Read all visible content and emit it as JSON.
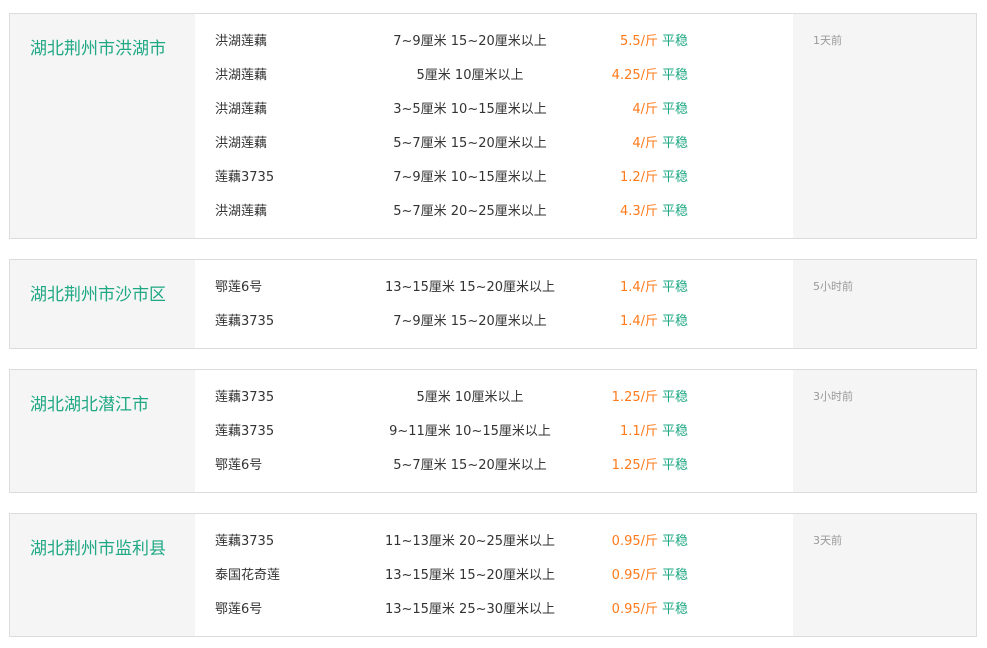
{
  "markets": [
    {
      "region": "湖北荆州市洪湖市",
      "time": "1天前",
      "rows": [
        {
          "variety": "洪湖莲藕",
          "spec": "7~9厘米 15~20厘米以上",
          "price": "5.5/斤",
          "trend": "平稳"
        },
        {
          "variety": "洪湖莲藕",
          "spec": "5厘米 10厘米以上",
          "price": "4.25/斤",
          "trend": "平稳"
        },
        {
          "variety": "洪湖莲藕",
          "spec": "3~5厘米 10~15厘米以上",
          "price": "4/斤",
          "trend": "平稳"
        },
        {
          "variety": "洪湖莲藕",
          "spec": "5~7厘米 15~20厘米以上",
          "price": "4/斤",
          "trend": "平稳"
        },
        {
          "variety": "莲藕3735",
          "spec": "7~9厘米 10~15厘米以上",
          "price": "1.2/斤",
          "trend": "平稳"
        },
        {
          "variety": "洪湖莲藕",
          "spec": "5~7厘米 20~25厘米以上",
          "price": "4.3/斤",
          "trend": "平稳"
        }
      ]
    },
    {
      "region": "湖北荆州市沙市区",
      "time": "5小时前",
      "rows": [
        {
          "variety": "鄂莲6号",
          "spec": "13~15厘米 15~20厘米以上",
          "price": "1.4/斤",
          "trend": "平稳"
        },
        {
          "variety": "莲藕3735",
          "spec": "7~9厘米 15~20厘米以上",
          "price": "1.4/斤",
          "trend": "平稳"
        }
      ]
    },
    {
      "region": "湖北湖北潜江市",
      "time": "3小时前",
      "rows": [
        {
          "variety": "莲藕3735",
          "spec": "5厘米 10厘米以上",
          "price": "1.25/斤",
          "trend": "平稳"
        },
        {
          "variety": "莲藕3735",
          "spec": "9~11厘米 10~15厘米以上",
          "price": "1.1/斤",
          "trend": "平稳"
        },
        {
          "variety": "鄂莲6号",
          "spec": "5~7厘米 15~20厘米以上",
          "price": "1.25/斤",
          "trend": "平稳"
        }
      ]
    },
    {
      "region": "湖北荆州市监利县",
      "time": "3天前",
      "rows": [
        {
          "variety": "莲藕3735",
          "spec": "11~13厘米 20~25厘米以上",
          "price": "0.95/斤",
          "trend": "平稳"
        },
        {
          "variety": "泰国花奇莲",
          "spec": "13~15厘米 15~20厘米以上",
          "price": "0.95/斤",
          "trend": "平稳"
        },
        {
          "variety": "鄂莲6号",
          "spec": "13~15厘米 25~30厘米以上",
          "price": "0.95/斤",
          "trend": "平稳"
        }
      ]
    }
  ],
  "colors": {
    "region": "#1ea883",
    "price": "#ff7a1a",
    "trend": "#1ea883"
  }
}
